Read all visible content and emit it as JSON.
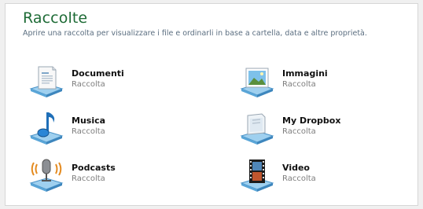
{
  "header": {
    "title": "Raccolte",
    "subtitle": "Aprire una raccolta per visualizzare i file e ordinarli in base a cartella, data e altre proprietà."
  },
  "libraries": [
    {
      "name": "Documenti",
      "type": "Raccolta",
      "icon": "documents-library-icon"
    },
    {
      "name": "Immagini",
      "type": "Raccolta",
      "icon": "pictures-library-icon"
    },
    {
      "name": "Musica",
      "type": "Raccolta",
      "icon": "music-library-icon"
    },
    {
      "name": "My Dropbox",
      "type": "Raccolta",
      "icon": "dropbox-library-icon"
    },
    {
      "name": "Podcasts",
      "type": "Raccolta",
      "icon": "podcasts-library-icon"
    },
    {
      "name": "Video",
      "type": "Raccolta",
      "icon": "video-library-icon"
    }
  ],
  "colors": {
    "title": "#1e6b36",
    "subtitle": "#5b6e80",
    "library_type": "#7d7d7d"
  }
}
